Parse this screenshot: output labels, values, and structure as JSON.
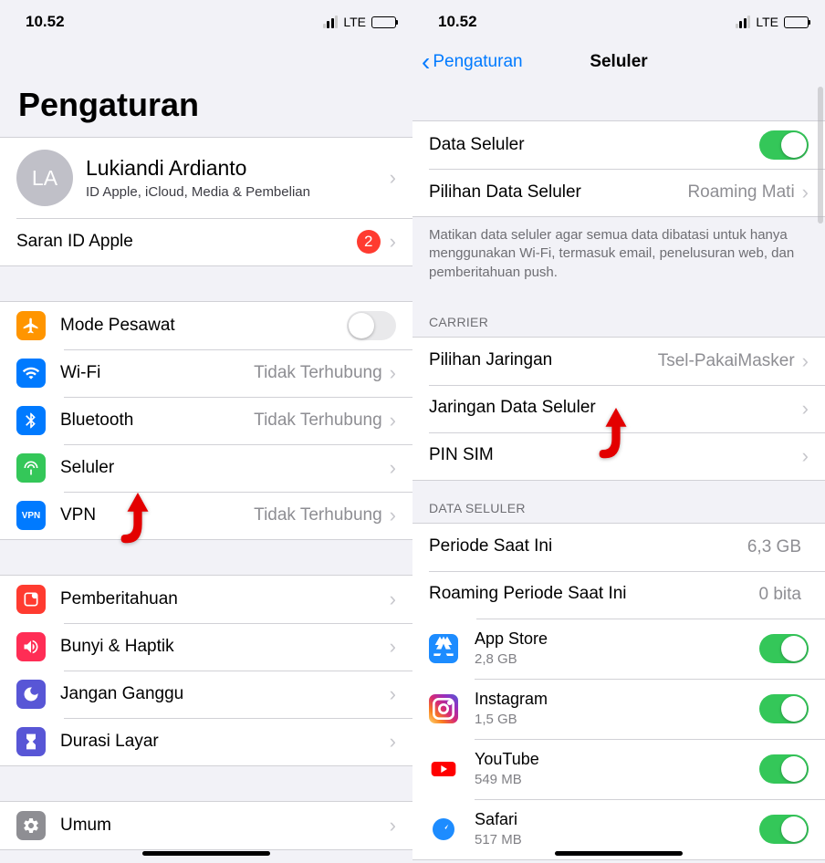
{
  "status": {
    "time": "10.52",
    "network": "LTE"
  },
  "left": {
    "page_title": "Pengaturan",
    "profile": {
      "initials": "LA",
      "name": "Lukiandi Ardianto",
      "caption": "ID Apple, iCloud, Media & Pembelian"
    },
    "suggestion": {
      "label": "Saran ID Apple",
      "badge": "2"
    },
    "airplane": {
      "label": "Mode Pesawat"
    },
    "wifi": {
      "label": "Wi-Fi",
      "value": "Tidak Terhubung"
    },
    "bluetooth": {
      "label": "Bluetooth",
      "value": "Tidak Terhubung"
    },
    "cellular": {
      "label": "Seluler"
    },
    "vpn": {
      "label": "VPN",
      "value": "Tidak Terhubung"
    },
    "notifications": {
      "label": "Pemberitahuan"
    },
    "sounds": {
      "label": "Bunyi & Haptik"
    },
    "dnd": {
      "label": "Jangan Ganggu"
    },
    "screentime": {
      "label": "Durasi Layar"
    },
    "general": {
      "label": "Umum"
    }
  },
  "right": {
    "nav_back": "Pengaturan",
    "nav_title": "Seluler",
    "cellular_data": {
      "label": "Data Seluler"
    },
    "data_options": {
      "label": "Pilihan Data Seluler",
      "value": "Roaming Mati"
    },
    "footer1": "Matikan data seluler agar semua data dibatasi untuk hanya menggunakan Wi-Fi, termasuk email, penelusuran web, dan pemberitahuan push.",
    "carrier_header": "CARRIER",
    "network_selection": {
      "label": "Pilihan Jaringan",
      "value": "Tsel-PakaiMasker"
    },
    "data_network": {
      "label": "Jaringan Data Seluler"
    },
    "sim_pin": {
      "label": "PIN SIM"
    },
    "data_header": "DATA SELULER",
    "current_period": {
      "label": "Periode Saat Ini",
      "value": "6,3 GB"
    },
    "roaming_period": {
      "label": "Roaming Periode Saat Ini",
      "value": "0 bita"
    },
    "apps": {
      "appstore": {
        "name": "App Store",
        "usage": "2,8 GB"
      },
      "instagram": {
        "name": "Instagram",
        "usage": "1,5 GB"
      },
      "youtube": {
        "name": "YouTube",
        "usage": "549 MB"
      },
      "safari": {
        "name": "Safari",
        "usage": "517 MB"
      }
    }
  }
}
